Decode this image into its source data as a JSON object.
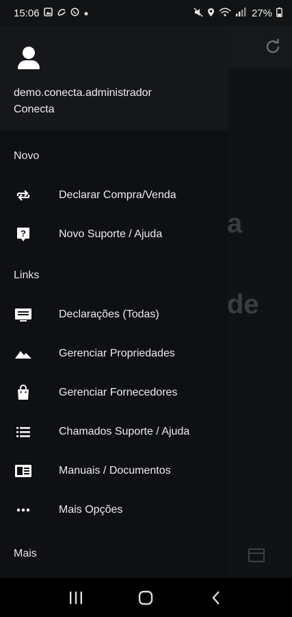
{
  "status_bar": {
    "time": "15:06",
    "battery": "27%",
    "left_icons": [
      "image-icon",
      "sync-icon",
      "whatsapp-icon",
      "dot-icon"
    ],
    "right_icons": [
      "mute-icon",
      "location-icon",
      "wifi-icon",
      "signal-icon",
      "battery-icon"
    ]
  },
  "background_app": {
    "text_1": "a",
    "text_2": "de"
  },
  "drawer": {
    "user_name": "demo.conecta.administrador",
    "user_org": "Conecta",
    "sections": [
      {
        "title": "Novo",
        "items": [
          {
            "label": "Declarar Compra/Venda",
            "icon": "swap-icon"
          },
          {
            "label": "Novo Suporte / Ajuda",
            "icon": "help-icon"
          }
        ]
      },
      {
        "title": "Links",
        "items": [
          {
            "label": "Declarações (Todas)",
            "icon": "monitor-icon"
          },
          {
            "label": "Gerenciar Propriedades",
            "icon": "terrain-icon"
          },
          {
            "label": "Gerenciar Fornecedores",
            "icon": "shopping-bag-icon"
          },
          {
            "label": "Chamados Suporte / Ajuda",
            "icon": "list-icon"
          },
          {
            "label": "Manuais / Documentos",
            "icon": "book-icon"
          },
          {
            "label": "Mais Opções",
            "icon": "more-icon"
          }
        ]
      },
      {
        "title": "Mais",
        "items": []
      }
    ]
  },
  "nav_bar": [
    "recents-icon",
    "home-icon",
    "back-icon"
  ]
}
